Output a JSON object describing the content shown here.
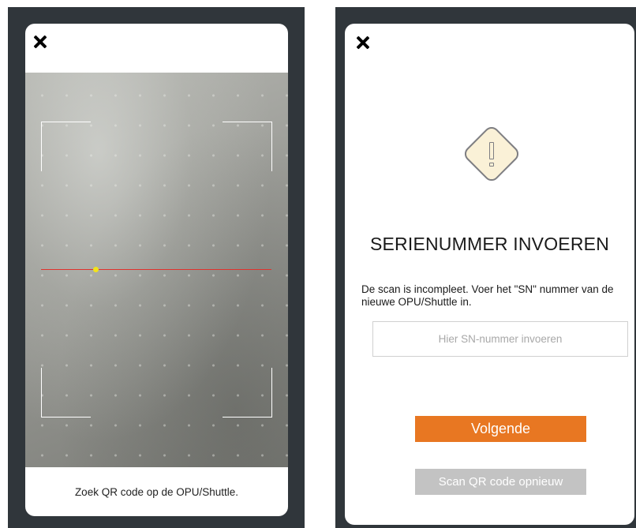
{
  "scan_screen": {
    "hint": "Zoek QR code op de OPU/Shuttle."
  },
  "serial_screen": {
    "title": "SERIENUMMER INVOEREN",
    "description": "De scan is incompleet. Voer het \"SN\" nummer van de nieuwe OPU/Shuttle in.",
    "input_placeholder": "Hier SN-nummer invoeren",
    "input_value": "",
    "next_button": "Volgende",
    "rescan_button": "Scan QR code opnieuw",
    "warning_icon": "warning-diamond-icon"
  },
  "colors": {
    "frame": "#30363b",
    "primary_button": "#e87722",
    "secondary_button": "#c3c3c3",
    "scan_line": "#e0322d",
    "scan_dot": "#f2e31a",
    "warning_fill": "#faf1d7"
  },
  "icons": {
    "close": "close-icon",
    "warning": "warning-icon"
  }
}
